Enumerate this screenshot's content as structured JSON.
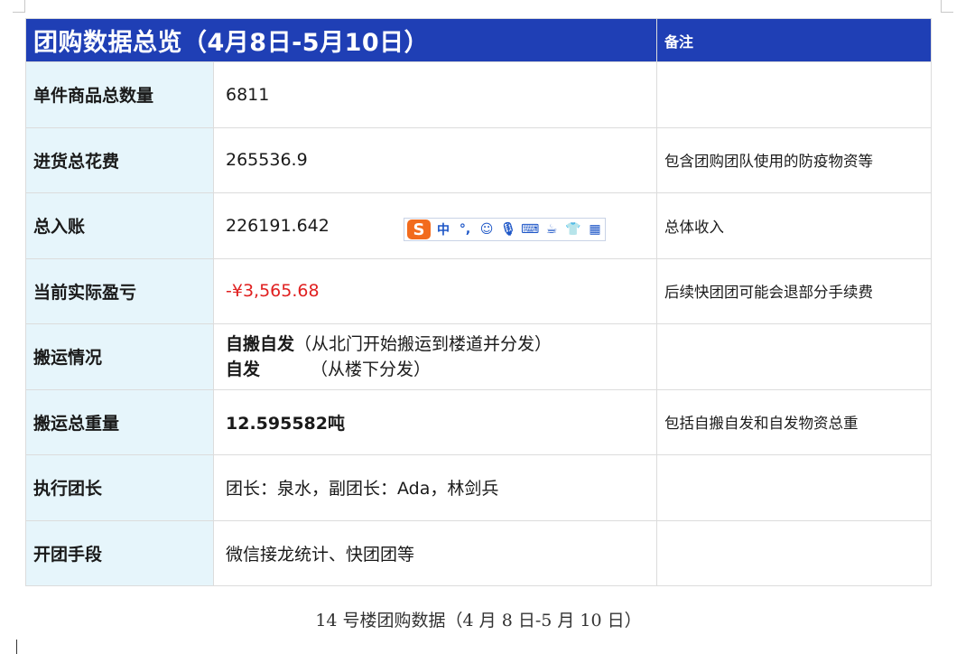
{
  "table": {
    "title": "团购数据总览（4月8日-5月10日）",
    "note_header": "备注",
    "rows": [
      {
        "label": "单件商品总数量",
        "value": "6811",
        "note": ""
      },
      {
        "label": "进货总花费",
        "value": "265536.9",
        "note": "包含团购团队使用的防疫物资等"
      },
      {
        "label": "总入账",
        "value": "226191.642",
        "note": "总体收入"
      },
      {
        "label": "当前实际盈亏",
        "value": "-¥3,565.68",
        "note": "后续快团团可能会退部分手续费"
      },
      {
        "label": "搬运情况",
        "value_line1_strong": "自搬自发",
        "value_line1_rest": "（从北门开始搬运到楼道并分发）",
        "value_line2_strong": "自发",
        "value_line2_rest": "（从楼下分发）",
        "note": ""
      },
      {
        "label": "搬运总重量",
        "value": "12.595582吨",
        "note": "包括自搬自发和自发物资总重"
      },
      {
        "label": "执行团长",
        "value": "团长：泉水，副团长：Ada，林剑兵",
        "note": ""
      },
      {
        "label": "开团手段",
        "value": "微信接龙统计、快团团等",
        "note": ""
      }
    ]
  },
  "caption": "14 号楼团购数据（4 月 8 日-5 月 10 日）",
  "ime_toolbar": {
    "logo": "S",
    "items": [
      {
        "icon": "chinese-mode-icon",
        "glyph": "中"
      },
      {
        "icon": "punctuation-icon",
        "glyph": "°,"
      },
      {
        "icon": "emoji-icon",
        "glyph": "☺"
      },
      {
        "icon": "microphone-icon",
        "glyph": "🎙"
      },
      {
        "icon": "keyboard-icon",
        "glyph": "⌨"
      },
      {
        "icon": "user-icon",
        "glyph": "☕"
      },
      {
        "icon": "skin-icon",
        "glyph": "👕"
      },
      {
        "icon": "toolbox-icon",
        "glyph": "▦"
      }
    ]
  },
  "colors": {
    "header_bg": "#1f3fb5",
    "label_bg": "#e6f5fb",
    "negative": "#e02020",
    "ime_logo": "#f26b1d"
  }
}
